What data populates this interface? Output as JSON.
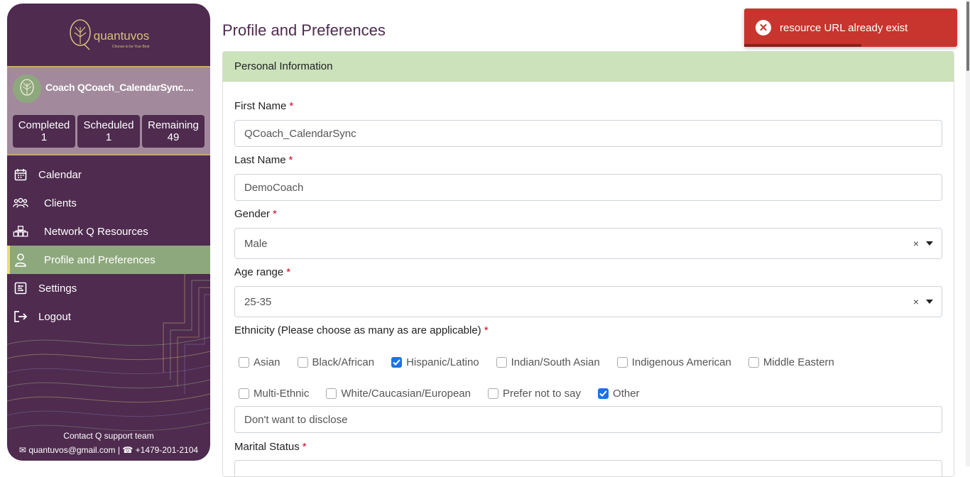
{
  "brand": {
    "name": "quantuvos",
    "tagline": "Choose to be Your Best"
  },
  "profile": {
    "name": "Coach QCoach_CalendarSync....",
    "stats": [
      {
        "label": "Completed",
        "value": "1"
      },
      {
        "label": "Scheduled",
        "value": "1"
      },
      {
        "label": "Remaining",
        "value": "49"
      }
    ]
  },
  "nav": {
    "items": [
      {
        "label": "Calendar",
        "icon": "calendar-icon"
      },
      {
        "label": "Clients",
        "icon": "users-icon"
      },
      {
        "label": "Network Q Resources",
        "icon": "network-icon"
      },
      {
        "label": "Profile and Preferences",
        "icon": "user-icon",
        "active": true
      },
      {
        "label": "Settings",
        "icon": "settings-icon"
      },
      {
        "label": "Logout",
        "icon": "logout-icon"
      }
    ]
  },
  "footer": {
    "contact": "Contact Q support team",
    "email": "quantuvos@gmail.com",
    "phone": "+1479-201-2104"
  },
  "page": {
    "title": "Profile and Preferences"
  },
  "section": {
    "title": "Personal Information"
  },
  "form": {
    "first_name": {
      "label": "First Name",
      "value": "QCoach_CalendarSync"
    },
    "last_name": {
      "label": "Last Name",
      "value": "DemoCoach"
    },
    "gender": {
      "label": "Gender",
      "value": "Male"
    },
    "age_range": {
      "label": "Age range",
      "value": "25-35"
    },
    "ethnicity": {
      "label": "Ethnicity (Please choose as many as are applicable)",
      "options": [
        {
          "label": "Asian",
          "checked": false
        },
        {
          "label": "Black/African",
          "checked": false
        },
        {
          "label": "Hispanic/Latino",
          "checked": true
        },
        {
          "label": "Indian/South Asian",
          "checked": false
        },
        {
          "label": "Indigenous American",
          "checked": false
        },
        {
          "label": "Middle Eastern",
          "checked": false
        },
        {
          "label": "Multi-Ethnic",
          "checked": false
        },
        {
          "label": "White/Caucasian/European",
          "checked": false
        },
        {
          "label": "Prefer not to say",
          "checked": false
        },
        {
          "label": "Other",
          "checked": true
        }
      ],
      "other_value": "Don't want to disclose"
    },
    "marital_status": {
      "label": "Marital Status"
    },
    "required_marker": "*",
    "clear_glyph": "×"
  },
  "toast": {
    "message": "resource URL already exist",
    "progress": 0.55
  },
  "colors": {
    "sidebar": "#4e2b4f",
    "accent_green": "#8ea87d",
    "header_green": "#cbe2bb",
    "toast_red": "#c8352e",
    "required": "#d0021b",
    "check_blue": "#1a73e8"
  }
}
